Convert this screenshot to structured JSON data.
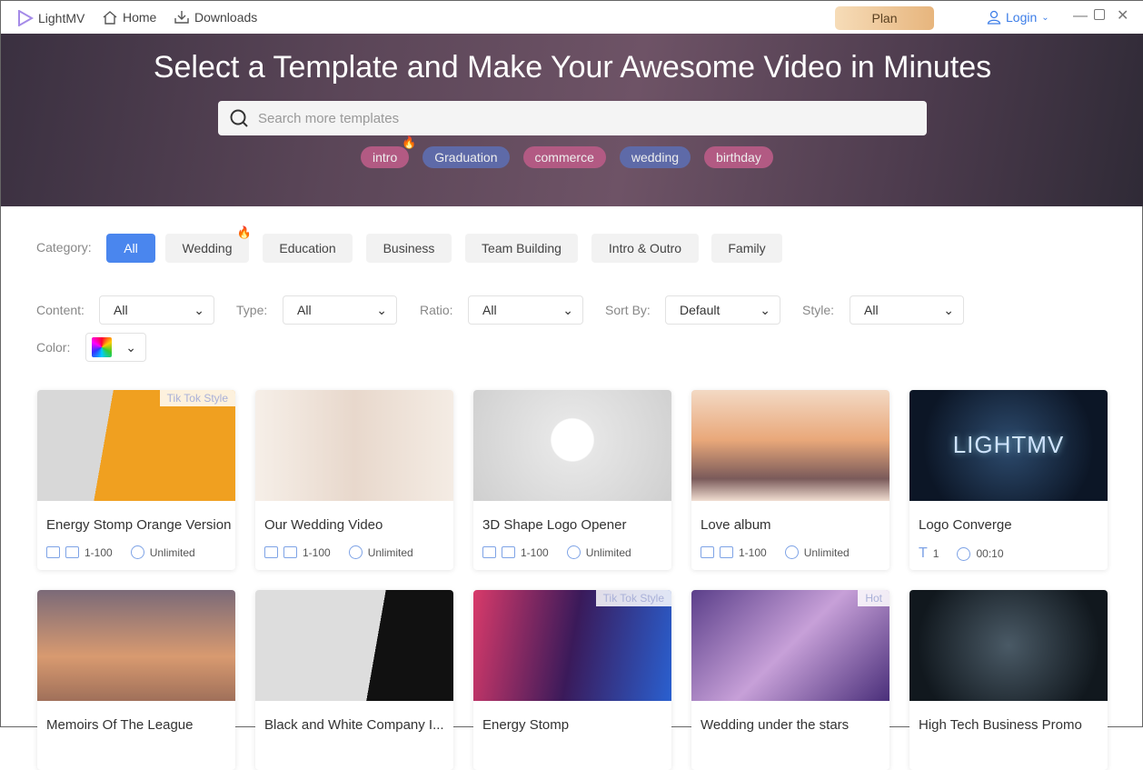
{
  "app": {
    "name": "LightMV",
    "nav": [
      {
        "label": "Home",
        "icon": "home-icon"
      },
      {
        "label": "Downloads",
        "icon": "download-icon"
      }
    ],
    "plan": "Plan",
    "login": "Login"
  },
  "hero": {
    "title": "Select a Template and Make Your Awesome Video in Minutes",
    "search_placeholder": "Search more templates",
    "tags": [
      {
        "label": "intro",
        "color": "#b25a83",
        "hot": true
      },
      {
        "label": "Graduation",
        "color": "#5e6aa8"
      },
      {
        "label": "commerce",
        "color": "#b25a83"
      },
      {
        "label": "wedding",
        "color": "#5e6aa8"
      },
      {
        "label": "birthday",
        "color": "#b25a83"
      }
    ]
  },
  "category": {
    "label": "Category:",
    "items": [
      "All",
      "Wedding",
      "Education",
      "Business",
      "Team Building",
      "Intro & Outro",
      "Family"
    ],
    "active": "All",
    "hot": "Wedding"
  },
  "filters": [
    {
      "label": "Content:",
      "value": "All"
    },
    {
      "label": "Type:",
      "value": "All"
    },
    {
      "label": "Ratio:",
      "value": "All"
    },
    {
      "label": "Sort By:",
      "value": "Default"
    },
    {
      "label": "Style:",
      "value": "All"
    }
  ],
  "color_filter": {
    "label": "Color:"
  },
  "cards": [
    {
      "title": "Energy Stomp Orange Version",
      "badge": "Tik Tok Style",
      "range": "1-100",
      "duration": "Unlimited",
      "bg": "linear-gradient(100deg,#d8d8d8 0 35%,#f0a020 35% 100%)"
    },
    {
      "title": "Our Wedding Video",
      "badge": "",
      "range": "1-100",
      "duration": "Unlimited",
      "bg": "linear-gradient(90deg,#f6efe8,#e8d8cc 50%,#f4ece4)"
    },
    {
      "title": "3D Shape Logo Opener",
      "badge": "",
      "range": "1-100",
      "duration": "Unlimited",
      "bg": "radial-gradient(circle at 50% 45%,#fff 0 18%,#e6e6e6 19%,#cfcfcf 100%)"
    },
    {
      "title": "Love album",
      "badge": "",
      "range": "1-100",
      "duration": "Unlimited",
      "bg": "linear-gradient(180deg,#f3d9c4 0,#e9a87a 45%,#7a5a5a 80%,#f0ddd0 100%)"
    },
    {
      "title": "Logo Converge",
      "badge": "",
      "range": "1",
      "duration": "00:10",
      "text_type": true,
      "bg": "radial-gradient(circle at 50% 50%,#2d4b6e,#0c1626 75%)"
    },
    {
      "title": "Memoirs Of The League",
      "badge": "",
      "bg": "linear-gradient(180deg,#7b6a78,#d89a70 60%,#a0705a)"
    },
    {
      "title": "Black and White Company I...",
      "badge": "",
      "bg": "linear-gradient(100deg,#ddd 0 60%,#111 60%)"
    },
    {
      "title": "Energy Stomp",
      "badge": "Tik Tok Style",
      "bg": "linear-gradient(100deg,#d83a6a,#3a1a5a 50%,#2a60d0)"
    },
    {
      "title": "Wedding under the stars",
      "badge": "Hot",
      "bg": "linear-gradient(135deg,#5b3f8a,#c7a0d8 50%,#4a2f7a)"
    },
    {
      "title": "High Tech Business Promo",
      "badge": "",
      "bg": "radial-gradient(circle,#4a5a66,#11181e 80%)"
    }
  ],
  "card_thumb_text": {
    "logo": "LIGHTMV"
  }
}
